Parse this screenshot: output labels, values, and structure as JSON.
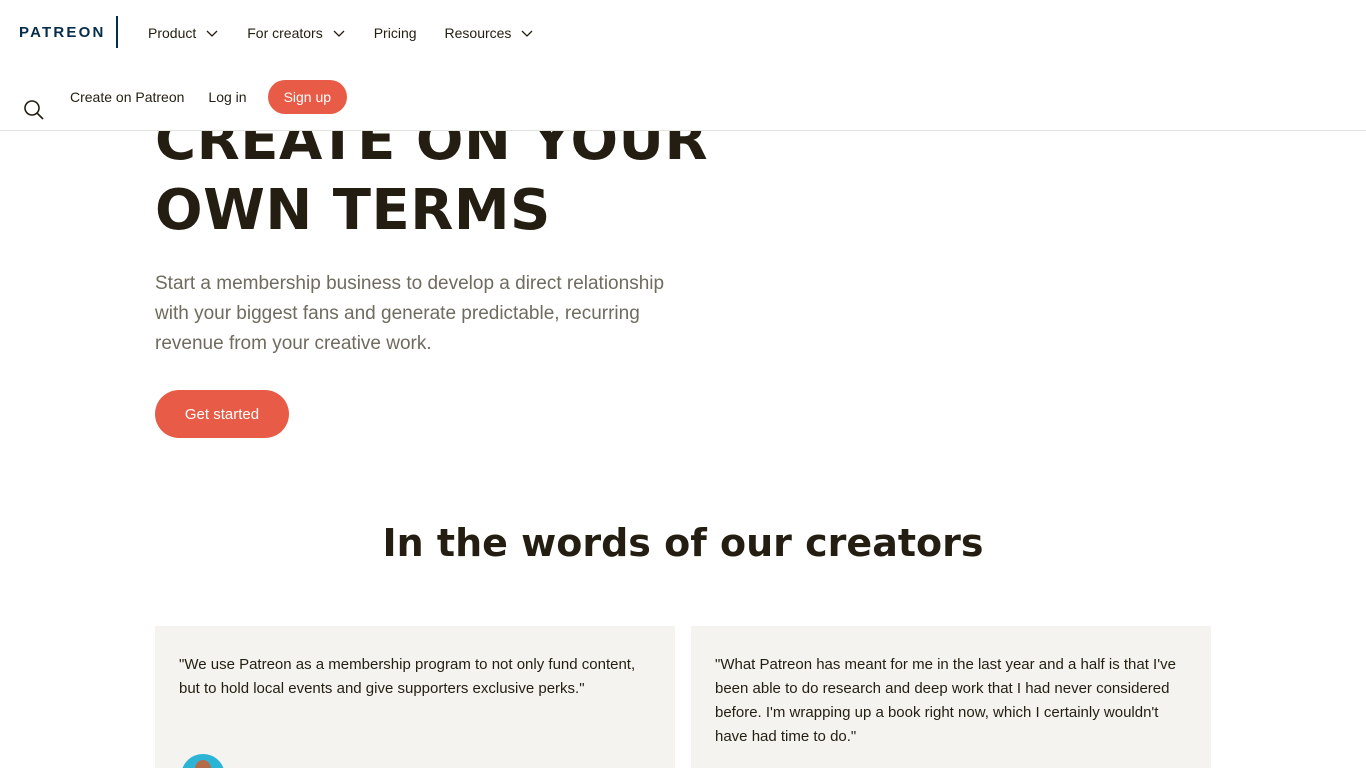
{
  "header": {
    "logo_text": "PATREON",
    "nav_top": [
      {
        "label": "Product",
        "has_dropdown": true
      },
      {
        "label": "For creators",
        "has_dropdown": true
      },
      {
        "label": "Pricing",
        "has_dropdown": false
      },
      {
        "label": "Resources",
        "has_dropdown": true
      }
    ],
    "nav_bottom": {
      "create_link": "Create on Patreon",
      "login_link": "Log in",
      "signup_button": "Sign up"
    },
    "search_icon": "search-icon"
  },
  "hero": {
    "title_line1": "CREATE ON YOUR",
    "title_line2": "OWN TERMS",
    "description": "Start a membership business to develop a direct relationship with your biggest fans and generate predictable, recurring revenue from your creative work.",
    "cta_button": "Get started"
  },
  "testimonials": {
    "heading": "In the words of our creators",
    "items": [
      {
        "quote": "\"We use Patreon as a membership program to not only fund content, but to hold local events and give supporters exclusive perks.\""
      },
      {
        "quote": "\"What Patreon has meant for me in the last year and a half is that I've been able to do research and deep work that I had never considered before. I'm wrapping up a book right now, which I certainly wouldn't have had time to do.\""
      }
    ]
  },
  "colors": {
    "brand_navy": "#052d49",
    "accent_coral": "#e85b46",
    "text_dark": "#241e12",
    "text_muted": "#706b5f",
    "card_bg": "#f4f3ef"
  }
}
